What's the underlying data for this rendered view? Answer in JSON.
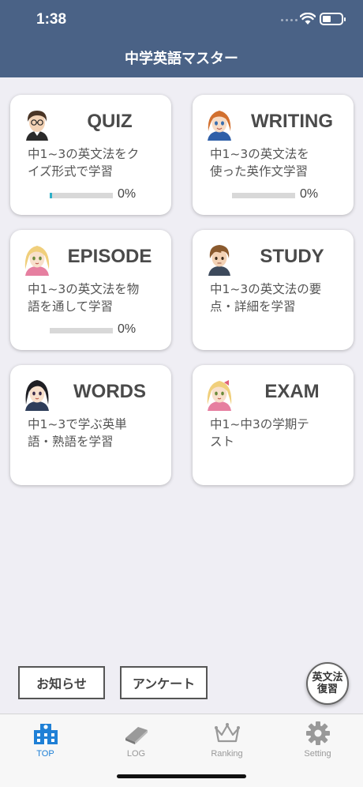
{
  "status_bar": {
    "time": "1:38"
  },
  "app": {
    "title": "中学英語マスター"
  },
  "cards": [
    {
      "title": "QUIZ",
      "desc_1": "中1~3の英文法をク",
      "desc_2": "イズ形式で学習",
      "progress": "0%",
      "progress_value": 0.02
    },
    {
      "title": "WRITING",
      "desc_1": "中1~3の英文法を",
      "desc_2": "使った英作文学習",
      "progress": "0%",
      "progress_value": 0
    },
    {
      "title": "EPISODE",
      "desc_1": "中1~3の英文法を物",
      "desc_2": "語を通して学習",
      "progress": "0%",
      "progress_value": 0
    },
    {
      "title": "STUDY",
      "desc_1": "中1~3の英文法の要",
      "desc_2": "点・詳細を学習"
    },
    {
      "title": "WORDS",
      "desc_1": "中1~3で学ぶ英単",
      "desc_2": "語・熟語を学習"
    },
    {
      "title": "EXAM",
      "desc_1": "中1~中3の学期テ",
      "desc_2": "スト"
    }
  ],
  "buttons": {
    "news": "お知らせ",
    "survey": "アンケート",
    "review_1": "英文法",
    "review_2": "復習"
  },
  "tabs": [
    {
      "label": "TOP",
      "icon": "school-building-icon",
      "active": true
    },
    {
      "label": "LOG",
      "icon": "book-icon",
      "active": false
    },
    {
      "label": "Ranking",
      "icon": "crown-icon",
      "active": false
    },
    {
      "label": "Setting",
      "icon": "gear-icon",
      "active": false
    }
  ],
  "colors": {
    "header": "#4a6286",
    "accent": "#1f80d6",
    "progress": "#2fb0c8",
    "background": "#efeef4"
  }
}
